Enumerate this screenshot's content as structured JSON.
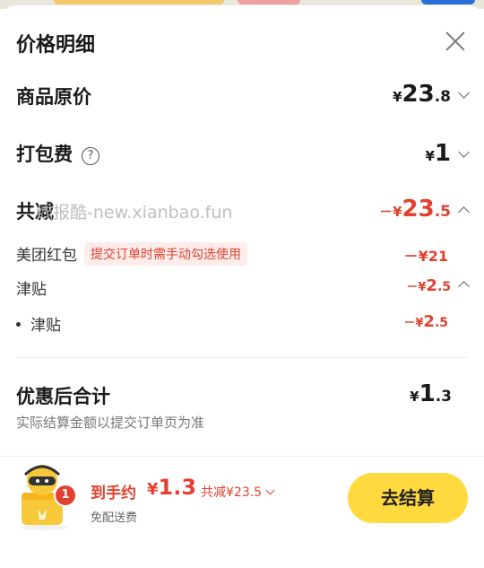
{
  "header": {
    "title": "价格明细"
  },
  "original_price": {
    "label": "商品原价",
    "yen": "¥",
    "int": "23",
    "dec": ".8"
  },
  "packaging_fee": {
    "label": "打包费",
    "help": "?",
    "yen": "¥",
    "int": "1"
  },
  "discount_total": {
    "label": "共减",
    "prefix": "－",
    "yen": "¥",
    "int": "23",
    "dec": ".5"
  },
  "watermark": "线报酷-new.xianbao.fun",
  "red_packet": {
    "label": "美团红包",
    "tag": "提交订单时需手动勾选使用",
    "value": "－¥21"
  },
  "subsidy": {
    "label": "津贴",
    "prefix": "－",
    "yen": "¥",
    "int": "2",
    "dec": ".5"
  },
  "subsidy_item": {
    "label": "津贴",
    "prefix": "－",
    "yen": "¥",
    "int": "2",
    "dec": ".5"
  },
  "total": {
    "label": "优惠后合计",
    "note": "实际结算金额以提交订单页为准",
    "yen": "¥",
    "int": "1",
    "dec": ".3"
  },
  "bottom_bar": {
    "badge_count": "1",
    "arrive_label": "到手约",
    "yen": "¥",
    "price": "1.3",
    "saved": "共减¥23.5",
    "free_delivery": "免配送费",
    "checkout_label": "去结算"
  },
  "colors": {
    "accent_red": "#e2412f",
    "checkout_yellow": "#ffd93d"
  }
}
